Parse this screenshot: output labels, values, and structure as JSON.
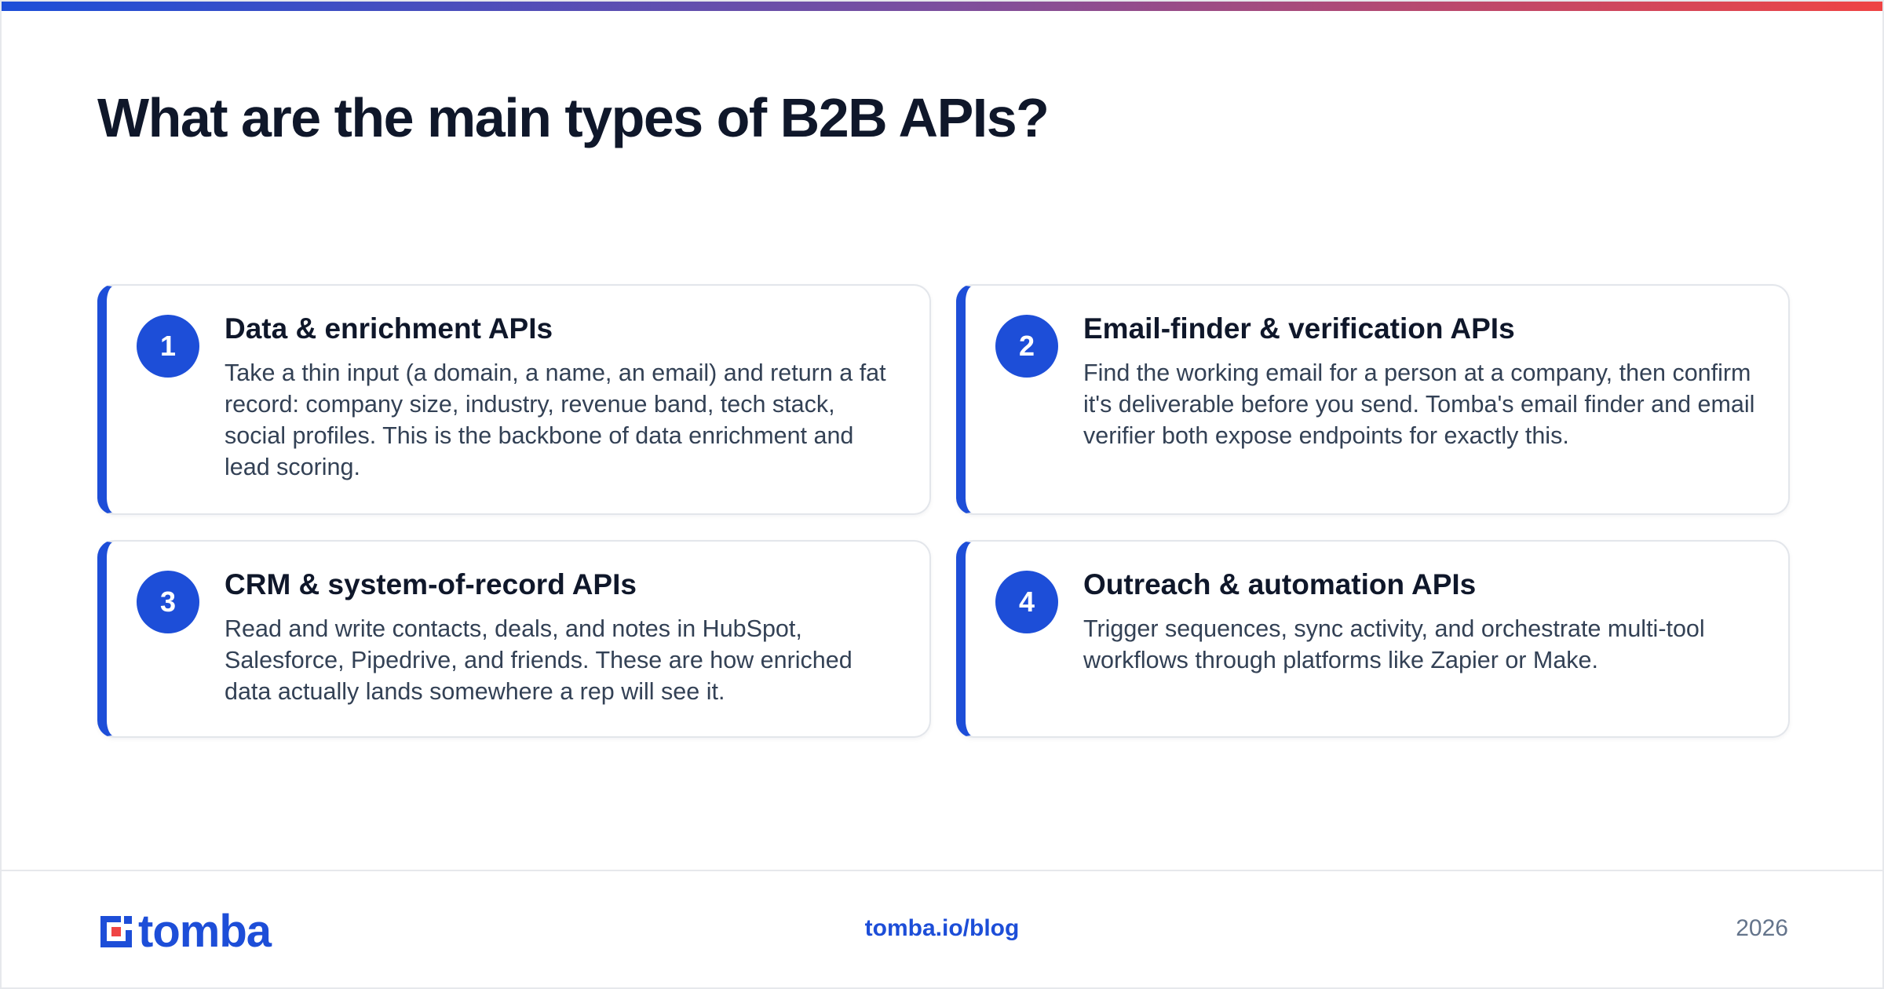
{
  "title": "What are the main types of B2B APIs?",
  "colors": {
    "accent": "#1d4ed8",
    "gradient_start": "#1d4ed8",
    "gradient_end": "#ef4444",
    "heading": "#0f172a",
    "body_text": "#334155",
    "muted": "#64748b"
  },
  "cards": [
    {
      "number": "1",
      "title": "Data & enrichment APIs",
      "text": "Take a thin input (a domain, a name, an email) and return a fat record: company size, industry, revenue band, tech stack, social profiles. This is the backbone of data enrichment and lead scoring."
    },
    {
      "number": "2",
      "title": "Email-finder & verification APIs",
      "text": "Find the working email for a person at a company, then confirm it's deliverable before you send. Tomba's email finder and email verifier both expose endpoints for exactly this."
    },
    {
      "number": "3",
      "title": "CRM & system-of-record APIs",
      "text": "Read and write contacts, deals, and notes in HubSpot, Salesforce, Pipedrive, and friends. These are how enriched data actually lands somewhere a rep will see it."
    },
    {
      "number": "4",
      "title": "Outreach & automation APIs",
      "text": "Trigger sequences, sync activity, and orchestrate multi-tool workflows through platforms like Zapier or Make."
    }
  ],
  "footer": {
    "logo_text": "tomba",
    "logo_icon": "tomba-logo-mark-icon",
    "link": "tomba.io/blog",
    "year": "2026"
  }
}
